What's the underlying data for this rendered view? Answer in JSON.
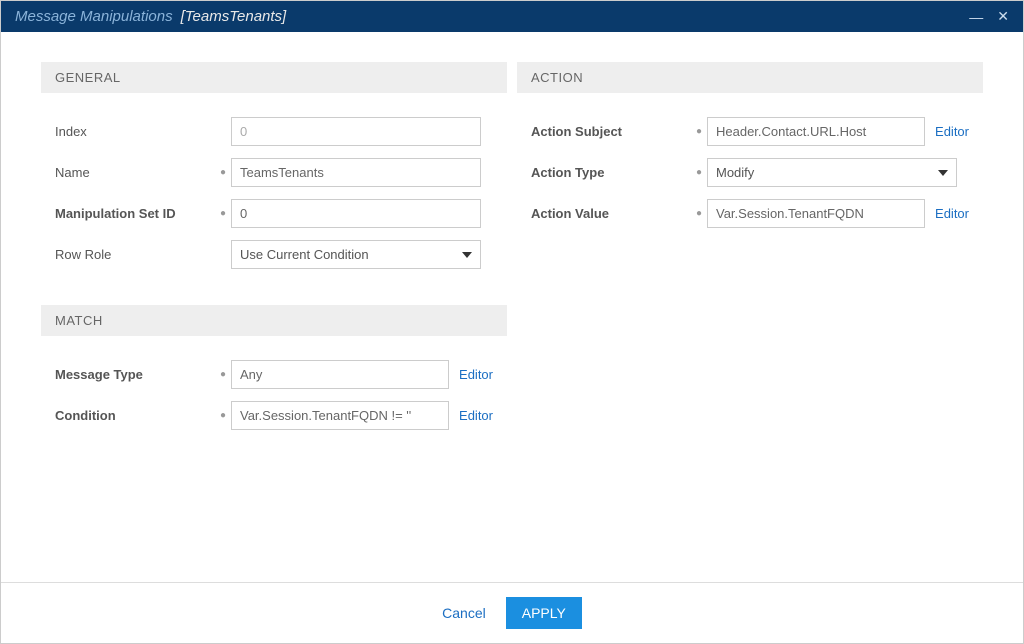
{
  "titlebar": {
    "title": "Message Manipulations",
    "context": "[TeamsTenants]"
  },
  "sections": {
    "general": {
      "header": "GENERAL",
      "index_label": "Index",
      "index_value": "0",
      "name_label": "Name",
      "name_value": "TeamsTenants",
      "manip_set_id_label": "Manipulation Set ID",
      "manip_set_id_value": "0",
      "row_role_label": "Row Role",
      "row_role_value": "Use Current Condition"
    },
    "match": {
      "header": "MATCH",
      "message_type_label": "Message Type",
      "message_type_value": "Any",
      "condition_label": "Condition",
      "condition_value": "Var.Session.TenantFQDN != ''"
    },
    "action": {
      "header": "ACTION",
      "subject_label": "Action Subject",
      "subject_value": "Header.Contact.URL.Host",
      "type_label": "Action Type",
      "type_value": "Modify",
      "value_label": "Action Value",
      "value_value": "Var.Session.TenantFQDN"
    }
  },
  "misc": {
    "editor": "Editor",
    "cancel": "Cancel",
    "apply": "APPLY"
  }
}
